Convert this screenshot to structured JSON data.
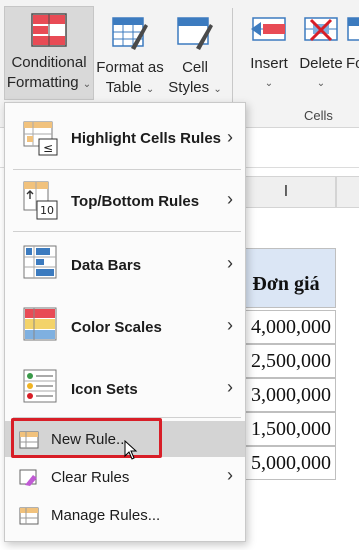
{
  "ribbon": {
    "conditional_formatting": {
      "line1": "Conditional",
      "line2": "Formatting"
    },
    "format_as_table": {
      "line1": "Format as",
      "line2": "Table"
    },
    "cell_styles": {
      "line1": "Cell",
      "line2": "Styles"
    },
    "insert": {
      "label": "Insert"
    },
    "delete": {
      "label": "Delete"
    },
    "format_partial": {
      "label": "Fo"
    },
    "group_cells": "Cells"
  },
  "sheet": {
    "column_header": "I",
    "price_header": "Đơn giá",
    "prices": [
      "4,000,000",
      "2,500,000",
      "3,000,000",
      "1,500,000",
      "5,000,000"
    ]
  },
  "menu": {
    "items": [
      {
        "label": "Highlight Cells Rules",
        "icon": "highlight-cells-rules-icon",
        "has_submenu": true
      },
      {
        "label": "Top/Bottom Rules",
        "icon": "top-bottom-rules-icon",
        "has_submenu": true
      },
      {
        "label": "Data Bars",
        "icon": "data-bars-icon",
        "has_submenu": true
      },
      {
        "label": "Color Scales",
        "icon": "color-scales-icon",
        "has_submenu": true
      },
      {
        "label": "Icon Sets",
        "icon": "icon-sets-icon",
        "has_submenu": true
      }
    ],
    "small_items": [
      {
        "label": "New Rule...",
        "icon": "new-rule-icon",
        "highlighted": true
      },
      {
        "label": "Clear Rules",
        "icon": "clear-rules-icon",
        "has_submenu": true
      },
      {
        "label": "Manage Rules...",
        "icon": "manage-rules-icon"
      }
    ],
    "icon_badges": {
      "highlight": "≤",
      "topbottom": "10"
    }
  },
  "colors": {
    "accent_red": "#d81e27",
    "ribbon_bg": "#f3f3f3",
    "header_fill": "#dbe6f5"
  }
}
